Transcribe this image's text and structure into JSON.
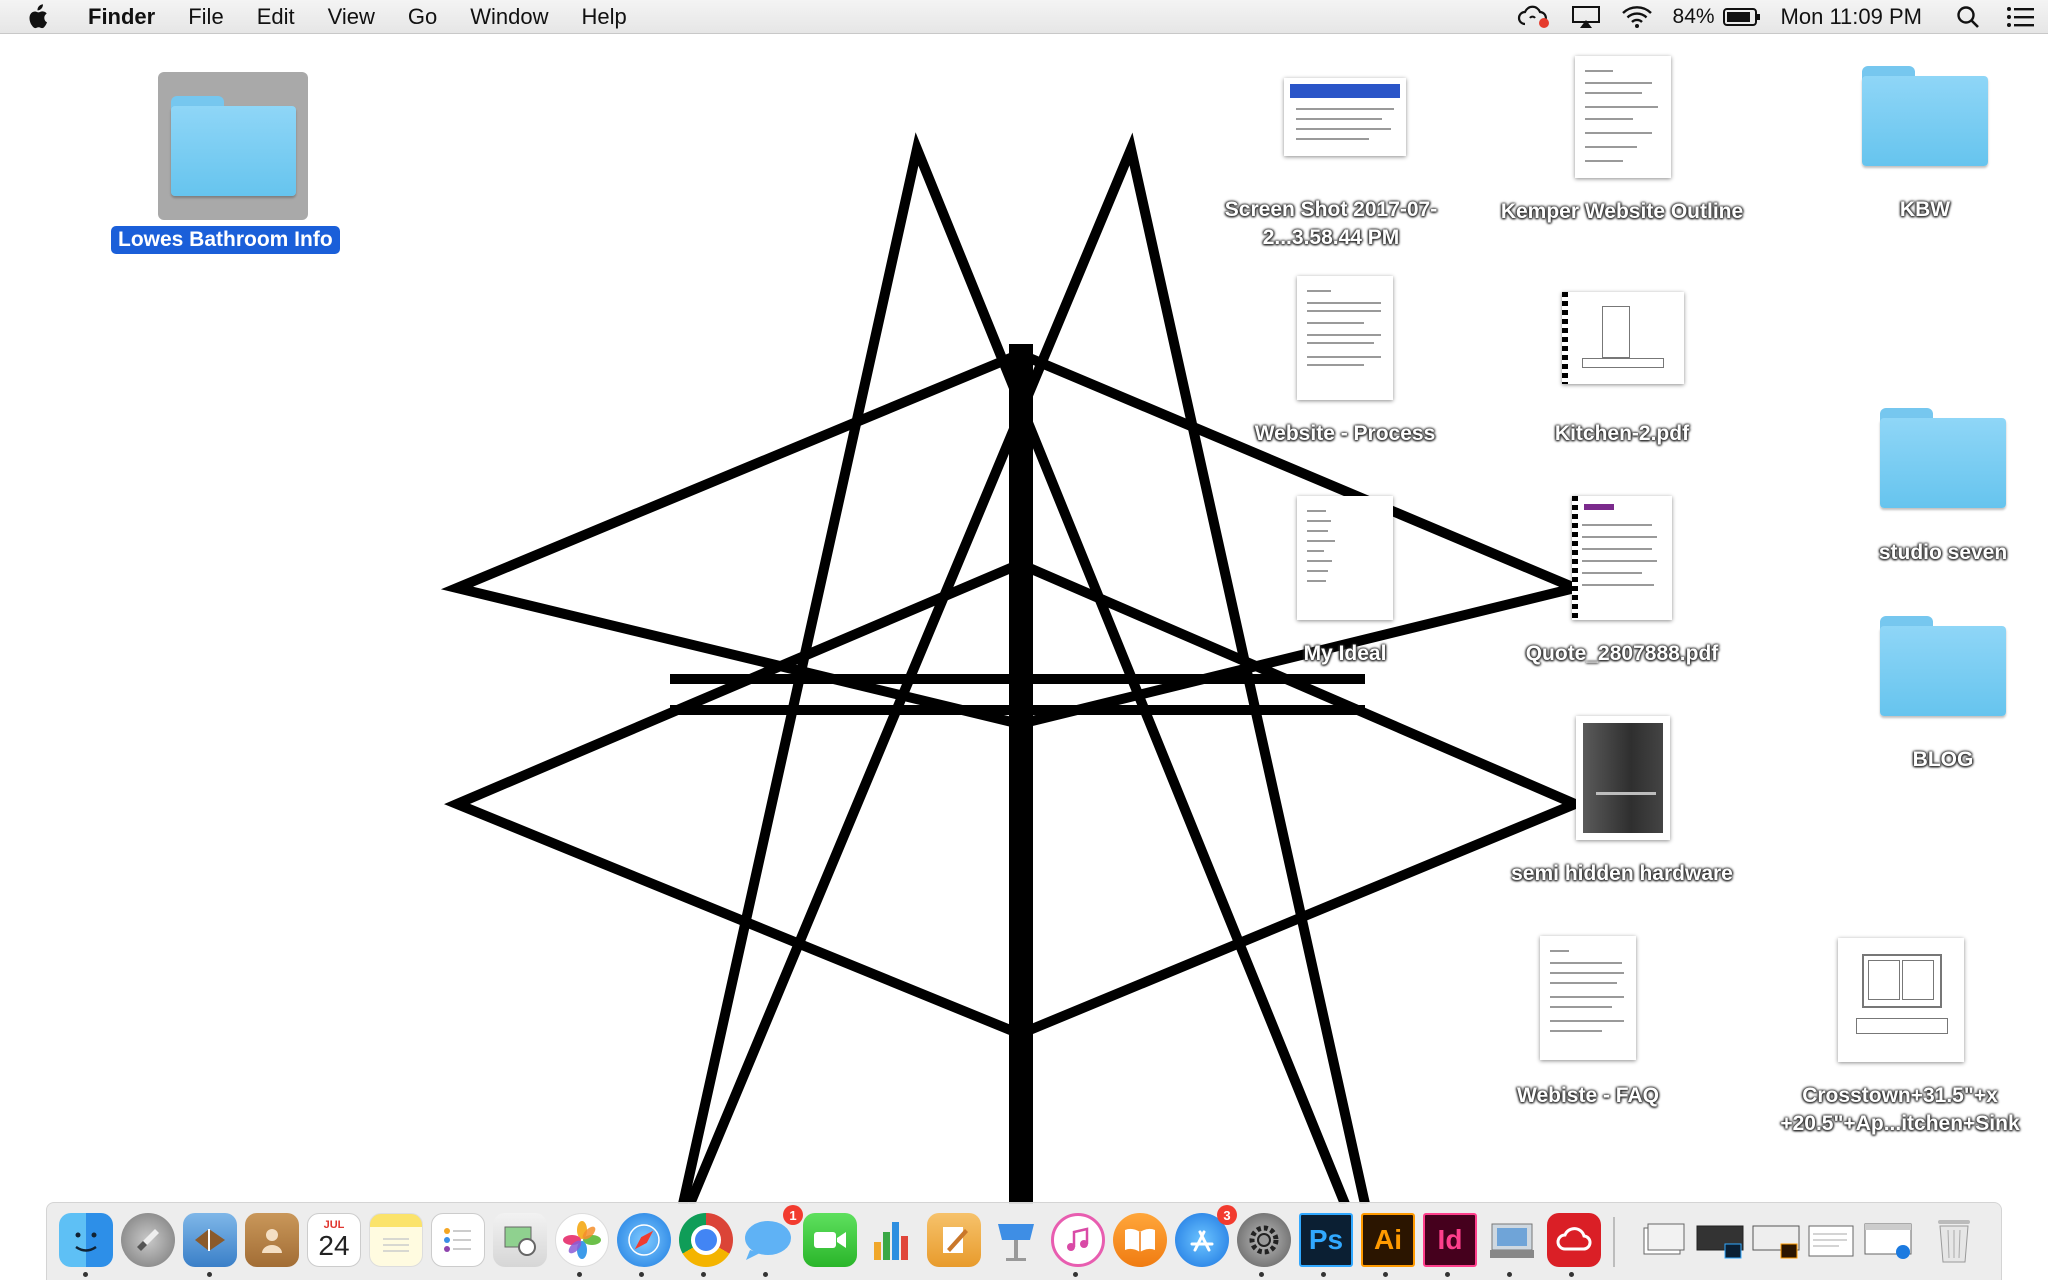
{
  "menubar": {
    "app_name": "Finder",
    "menus": [
      "File",
      "Edit",
      "View",
      "Go",
      "Window",
      "Help"
    ],
    "battery_percent": "84%",
    "clock": "Mon 11:09 PM"
  },
  "desktop": {
    "selected_folder": {
      "label": "Lowes Bathroom Info"
    },
    "items": [
      {
        "label": "Screen Shot 2017-07-2...3.58.44 PM",
        "kind": "screenshot"
      },
      {
        "label": "Kemper Website Outline",
        "kind": "document"
      },
      {
        "label": "KBW",
        "kind": "folder"
      },
      {
        "label": "Website - Process",
        "kind": "document"
      },
      {
        "label": "Kitchen-2.pdf",
        "kind": "pdf"
      },
      {
        "label": "studio seven",
        "kind": "folder"
      },
      {
        "label": "My Ideal",
        "kind": "document"
      },
      {
        "label": "Quote_2807888.pdf",
        "kind": "pdf"
      },
      {
        "label": "BLOG",
        "kind": "folder"
      },
      {
        "label": "semi hidden hardware",
        "kind": "image"
      },
      {
        "label": "Webiste - FAQ",
        "kind": "document"
      },
      {
        "label": "Crosstown+31.5\"+x +20.5\"+Ap...itchen+Sink",
        "kind": "image"
      }
    ]
  },
  "dock": {
    "calendar": {
      "month": "JUL",
      "day": "24"
    },
    "messages_badge": "1",
    "appstore_badge": "3",
    "apps": [
      {
        "name": "Finder",
        "icon": "finder-icon"
      },
      {
        "name": "Launchpad",
        "icon": "launchpad-icon"
      },
      {
        "name": "Mail",
        "icon": "mail-icon"
      },
      {
        "name": "Contacts",
        "icon": "contacts-icon"
      },
      {
        "name": "Calendar",
        "icon": "calendar-icon"
      },
      {
        "name": "Notes",
        "icon": "notes-icon"
      },
      {
        "name": "Reminders",
        "icon": "reminders-icon"
      },
      {
        "name": "Preview",
        "icon": "preview-icon"
      },
      {
        "name": "Photos",
        "icon": "photos-icon"
      },
      {
        "name": "Safari",
        "icon": "safari-icon"
      },
      {
        "name": "Chrome",
        "icon": "chrome-icon"
      },
      {
        "name": "Messages",
        "icon": "messages-icon"
      },
      {
        "name": "FaceTime",
        "icon": "facetime-icon"
      },
      {
        "name": "Numbers",
        "icon": "numbers-icon"
      },
      {
        "name": "Pages",
        "icon": "pages-icon"
      },
      {
        "name": "Keynote",
        "icon": "keynote-icon"
      },
      {
        "name": "iTunes",
        "icon": "itunes-icon"
      },
      {
        "name": "iBooks",
        "icon": "ibooks-icon"
      },
      {
        "name": "App Store",
        "icon": "app-store-icon"
      },
      {
        "name": "System Preferences",
        "icon": "gear-icon"
      },
      {
        "name": "Photoshop",
        "icon": "photoshop-icon",
        "text": "Ps"
      },
      {
        "name": "Illustrator",
        "icon": "illustrator-icon",
        "text": "Ai"
      },
      {
        "name": "InDesign",
        "icon": "indesign-icon",
        "text": "Id"
      },
      {
        "name": "Image Capture",
        "icon": "image-capture-icon"
      },
      {
        "name": "Creative Cloud",
        "icon": "creative-cloud-icon"
      }
    ]
  }
}
